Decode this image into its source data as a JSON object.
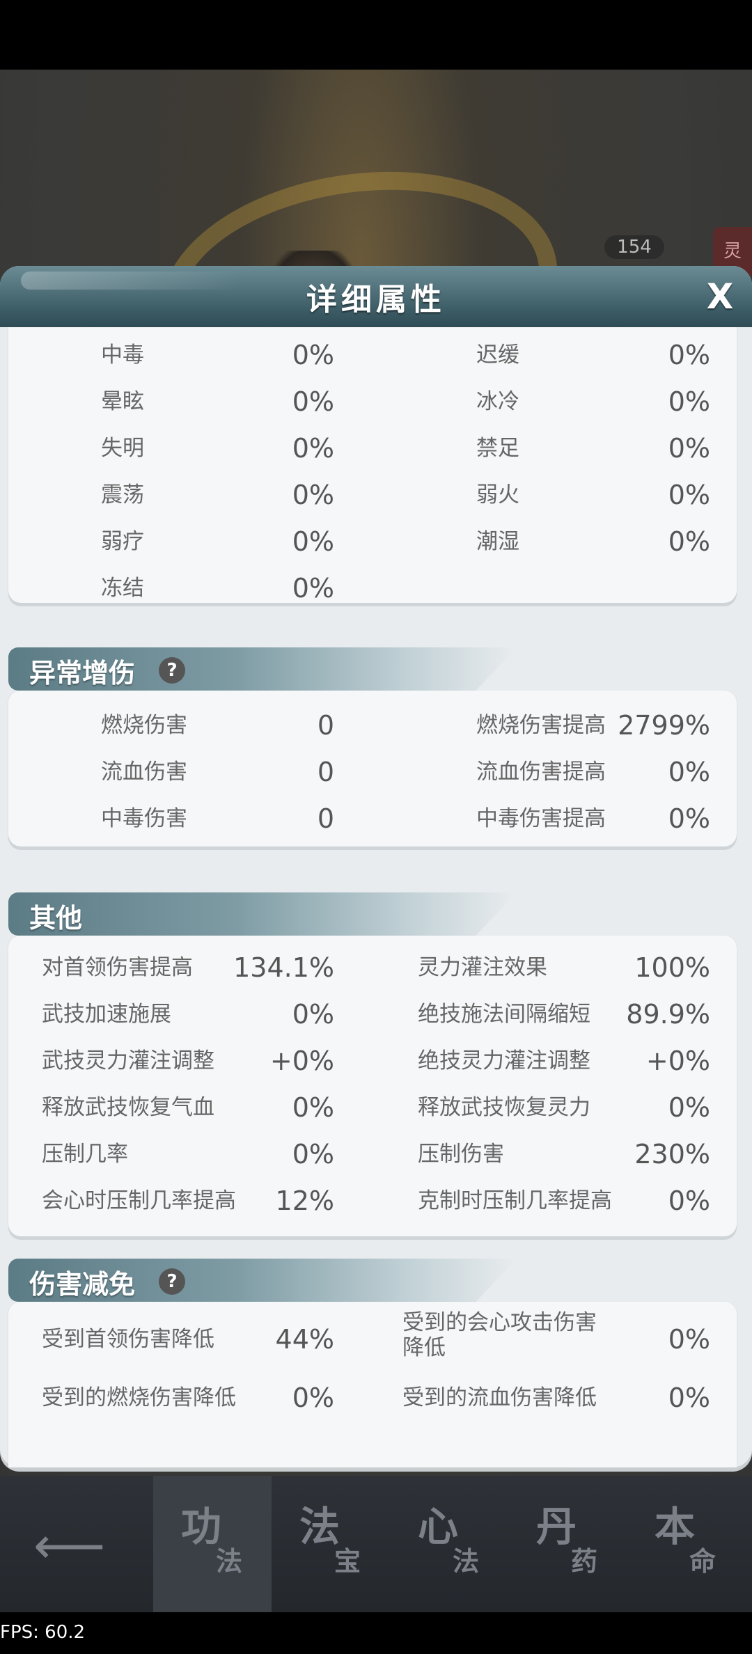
{
  "game": {
    "level_badge": "154",
    "side_tag": "灵"
  },
  "panel": {
    "title": "详细属性",
    "close_label": "X",
    "status_rows": [
      [
        {
          "label": "中毒",
          "value": "0%"
        },
        {
          "label": "迟缓",
          "value": "0%"
        }
      ],
      [
        {
          "label": "晕眩",
          "value": "0%"
        },
        {
          "label": "冰冷",
          "value": "0%"
        }
      ],
      [
        {
          "label": "失明",
          "value": "0%"
        },
        {
          "label": "禁足",
          "value": "0%"
        }
      ],
      [
        {
          "label": "震荡",
          "value": "0%"
        },
        {
          "label": "弱火",
          "value": "0%"
        }
      ],
      [
        {
          "label": "弱疗",
          "value": "0%"
        },
        {
          "label": "潮湿",
          "value": "0%"
        }
      ],
      [
        {
          "label": "冻结",
          "value": "0%"
        }
      ]
    ],
    "sections": [
      {
        "title": "异常增伤",
        "help": "?",
        "rows": [
          [
            {
              "label": "燃烧伤害",
              "value": "0"
            },
            {
              "label": "燃烧伤害提高",
              "value": "2799%"
            }
          ],
          [
            {
              "label": "流血伤害",
              "value": "0"
            },
            {
              "label": "流血伤害提高",
              "value": "0%"
            }
          ],
          [
            {
              "label": "中毒伤害",
              "value": "0"
            },
            {
              "label": "中毒伤害提高",
              "value": "0%"
            }
          ]
        ]
      },
      {
        "title": "其他",
        "rows": [
          [
            {
              "label": "对首领伤害提高",
              "value": "134.1%"
            },
            {
              "label": "灵力灌注效果",
              "value": "100%"
            }
          ],
          [
            {
              "label": "武技加速施展",
              "value": "0%"
            },
            {
              "label": "绝技施法间隔缩短",
              "value": "89.9%"
            }
          ],
          [
            {
              "label": "武技灵力灌注调整",
              "value": "+0%"
            },
            {
              "label": "绝技灵力灌注调整",
              "value": "+0%"
            }
          ],
          [
            {
              "label": "释放武技恢复气血",
              "value": "0%"
            },
            {
              "label": "释放武技恢复灵力",
              "value": "0%"
            }
          ],
          [
            {
              "label": "压制几率",
              "value": "0%"
            },
            {
              "label": "压制伤害",
              "value": "230%"
            }
          ],
          [
            {
              "label": "会心时压制几率提高",
              "value": "12%"
            },
            {
              "label": "克制时压制几率提高",
              "value": "0%"
            }
          ]
        ]
      },
      {
        "title": "伤害减免",
        "help": "?",
        "rows": [
          [
            {
              "label": "受到首领伤害降低",
              "value": "44%"
            },
            {
              "label": "受到的会心攻击伤害降低",
              "value": "0%"
            }
          ],
          [
            {
              "label": "受到的燃烧伤害降低",
              "value": "0%"
            },
            {
              "label": "受到的流血伤害降低",
              "value": "0%"
            }
          ]
        ]
      }
    ]
  },
  "bottom_nav": {
    "tabs": [
      {
        "big": "功",
        "small": "法"
      },
      {
        "big": "法",
        "small": "宝"
      },
      {
        "big": "心",
        "small": "法"
      },
      {
        "big": "丹",
        "small": "药"
      },
      {
        "big": "本",
        "small": "命"
      }
    ]
  },
  "fps": "FPS: 60.2"
}
